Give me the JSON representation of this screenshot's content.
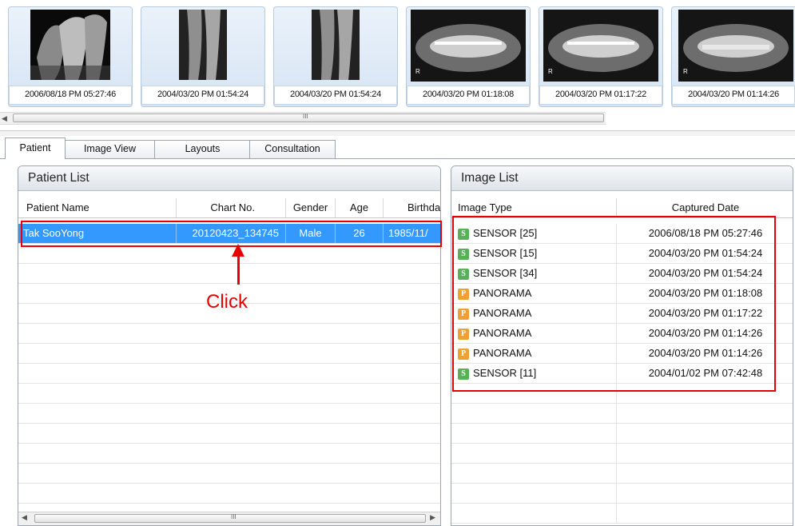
{
  "thumbnails": [
    {
      "caption": "2006/08/18 PM 05:27:46",
      "kind": "sensor"
    },
    {
      "caption": "2004/03/20 PM 01:54:24",
      "kind": "sensor"
    },
    {
      "caption": "2004/03/20 PM 01:54:24",
      "kind": "sensor"
    },
    {
      "caption": "2004/03/20 PM 01:18:08",
      "kind": "panorama"
    },
    {
      "caption": "2004/03/20 PM 01:17:22",
      "kind": "panorama"
    },
    {
      "caption": "2004/03/20 PM 01:14:26",
      "kind": "panorama"
    }
  ],
  "tabs": [
    {
      "label": "Patient",
      "active": true
    },
    {
      "label": "Image View",
      "active": false
    },
    {
      "label": "Layouts",
      "active": false
    },
    {
      "label": "Consultation",
      "active": false
    }
  ],
  "patient_list": {
    "title": "Patient List",
    "columns": [
      "Patient Name",
      "Chart No.",
      "Gender",
      "Age",
      "Birthday"
    ],
    "rows": [
      {
        "name": "Tak SooYong",
        "chart_no": "20120423_134745",
        "gender": "Male",
        "age": "26",
        "birthday": "1985/11/",
        "selected": true
      }
    ]
  },
  "image_list": {
    "title": "Image List",
    "columns": [
      "Image Type",
      "Captured Date"
    ],
    "rows": [
      {
        "badge": "S",
        "type": "SENSOR [25]",
        "date": "2006/08/18 PM 05:27:46"
      },
      {
        "badge": "S",
        "type": "SENSOR [15]",
        "date": "2004/03/20 PM 01:54:24"
      },
      {
        "badge": "S",
        "type": "SENSOR [34]",
        "date": "2004/03/20 PM 01:54:24"
      },
      {
        "badge": "P",
        "type": "PANORAMA",
        "date": "2004/03/20 PM 01:18:08"
      },
      {
        "badge": "P",
        "type": "PANORAMA",
        "date": "2004/03/20 PM 01:17:22"
      },
      {
        "badge": "P",
        "type": "PANORAMA",
        "date": "2004/03/20 PM 01:14:26"
      },
      {
        "badge": "P",
        "type": "PANORAMA",
        "date": "2004/03/20 PM 01:14:26"
      },
      {
        "badge": "S",
        "type": "SENSOR [11]",
        "date": "2004/01/02 PM 07:42:48"
      }
    ]
  },
  "annotation": {
    "label": "Click",
    "color": "#e60000"
  },
  "colors": {
    "selection": "#3399ff",
    "sensor_badge": "#58b058",
    "panorama_badge": "#f0a030"
  },
  "scrollbar_grip": "III"
}
